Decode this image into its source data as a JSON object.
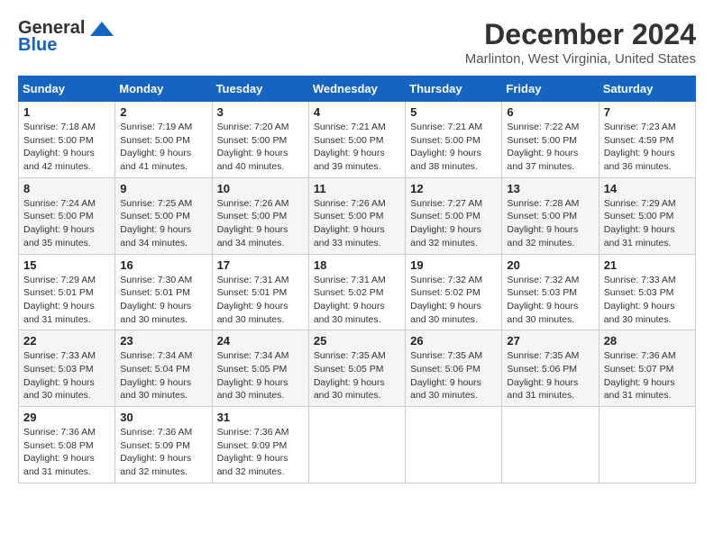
{
  "logo": {
    "general": "General",
    "blue": "Blue"
  },
  "title": "December 2024",
  "location": "Marlinton, West Virginia, United States",
  "days_of_week": [
    "Sunday",
    "Monday",
    "Tuesday",
    "Wednesday",
    "Thursday",
    "Friday",
    "Saturday"
  ],
  "weeks": [
    [
      {
        "day": 1,
        "info": "Sunrise: 7:18 AM\nSunset: 5:00 PM\nDaylight: 9 hours\nand 42 minutes."
      },
      {
        "day": 2,
        "info": "Sunrise: 7:19 AM\nSunset: 5:00 PM\nDaylight: 9 hours\nand 41 minutes."
      },
      {
        "day": 3,
        "info": "Sunrise: 7:20 AM\nSunset: 5:00 PM\nDaylight: 9 hours\nand 40 minutes."
      },
      {
        "day": 4,
        "info": "Sunrise: 7:21 AM\nSunset: 5:00 PM\nDaylight: 9 hours\nand 39 minutes."
      },
      {
        "day": 5,
        "info": "Sunrise: 7:21 AM\nSunset: 5:00 PM\nDaylight: 9 hours\nand 38 minutes."
      },
      {
        "day": 6,
        "info": "Sunrise: 7:22 AM\nSunset: 5:00 PM\nDaylight: 9 hours\nand 37 minutes."
      },
      {
        "day": 7,
        "info": "Sunrise: 7:23 AM\nSunset: 4:59 PM\nDaylight: 9 hours\nand 36 minutes."
      }
    ],
    [
      {
        "day": 8,
        "info": "Sunrise: 7:24 AM\nSunset: 5:00 PM\nDaylight: 9 hours\nand 35 minutes."
      },
      {
        "day": 9,
        "info": "Sunrise: 7:25 AM\nSunset: 5:00 PM\nDaylight: 9 hours\nand 34 minutes."
      },
      {
        "day": 10,
        "info": "Sunrise: 7:26 AM\nSunset: 5:00 PM\nDaylight: 9 hours\nand 34 minutes."
      },
      {
        "day": 11,
        "info": "Sunrise: 7:26 AM\nSunset: 5:00 PM\nDaylight: 9 hours\nand 33 minutes."
      },
      {
        "day": 12,
        "info": "Sunrise: 7:27 AM\nSunset: 5:00 PM\nDaylight: 9 hours\nand 32 minutes."
      },
      {
        "day": 13,
        "info": "Sunrise: 7:28 AM\nSunset: 5:00 PM\nDaylight: 9 hours\nand 32 minutes."
      },
      {
        "day": 14,
        "info": "Sunrise: 7:29 AM\nSunset: 5:00 PM\nDaylight: 9 hours\nand 31 minutes."
      }
    ],
    [
      {
        "day": 15,
        "info": "Sunrise: 7:29 AM\nSunset: 5:01 PM\nDaylight: 9 hours\nand 31 minutes."
      },
      {
        "day": 16,
        "info": "Sunrise: 7:30 AM\nSunset: 5:01 PM\nDaylight: 9 hours\nand 30 minutes."
      },
      {
        "day": 17,
        "info": "Sunrise: 7:31 AM\nSunset: 5:01 PM\nDaylight: 9 hours\nand 30 minutes."
      },
      {
        "day": 18,
        "info": "Sunrise: 7:31 AM\nSunset: 5:02 PM\nDaylight: 9 hours\nand 30 minutes."
      },
      {
        "day": 19,
        "info": "Sunrise: 7:32 AM\nSunset: 5:02 PM\nDaylight: 9 hours\nand 30 minutes."
      },
      {
        "day": 20,
        "info": "Sunrise: 7:32 AM\nSunset: 5:03 PM\nDaylight: 9 hours\nand 30 minutes."
      },
      {
        "day": 21,
        "info": "Sunrise: 7:33 AM\nSunset: 5:03 PM\nDaylight: 9 hours\nand 30 minutes."
      }
    ],
    [
      {
        "day": 22,
        "info": "Sunrise: 7:33 AM\nSunset: 5:03 PM\nDaylight: 9 hours\nand 30 minutes."
      },
      {
        "day": 23,
        "info": "Sunrise: 7:34 AM\nSunset: 5:04 PM\nDaylight: 9 hours\nand 30 minutes."
      },
      {
        "day": 24,
        "info": "Sunrise: 7:34 AM\nSunset: 5:05 PM\nDaylight: 9 hours\nand 30 minutes."
      },
      {
        "day": 25,
        "info": "Sunrise: 7:35 AM\nSunset: 5:05 PM\nDaylight: 9 hours\nand 30 minutes."
      },
      {
        "day": 26,
        "info": "Sunrise: 7:35 AM\nSunset: 5:06 PM\nDaylight: 9 hours\nand 30 minutes."
      },
      {
        "day": 27,
        "info": "Sunrise: 7:35 AM\nSunset: 5:06 PM\nDaylight: 9 hours\nand 31 minutes."
      },
      {
        "day": 28,
        "info": "Sunrise: 7:36 AM\nSunset: 5:07 PM\nDaylight: 9 hours\nand 31 minutes."
      }
    ],
    [
      {
        "day": 29,
        "info": "Sunrise: 7:36 AM\nSunset: 5:08 PM\nDaylight: 9 hours\nand 31 minutes."
      },
      {
        "day": 30,
        "info": "Sunrise: 7:36 AM\nSunset: 5:09 PM\nDaylight: 9 hours\nand 32 minutes."
      },
      {
        "day": 31,
        "info": "Sunrise: 7:36 AM\nSunset: 9:09 PM\nDaylight: 9 hours\nand 32 minutes."
      },
      null,
      null,
      null,
      null
    ]
  ]
}
